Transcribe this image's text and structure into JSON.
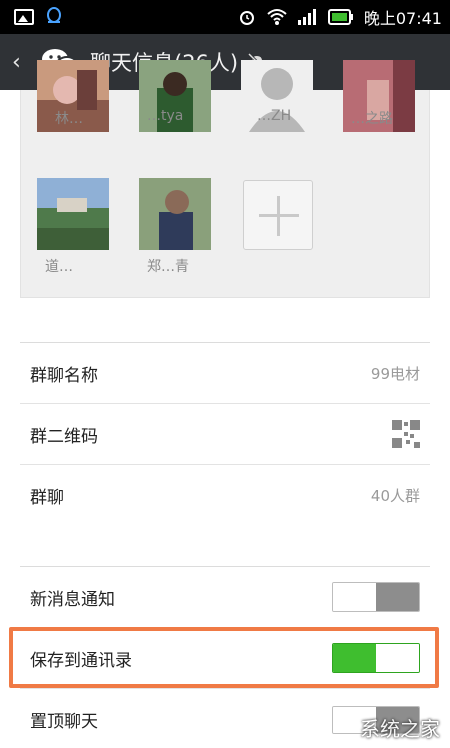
{
  "statusbar": {
    "time": "晚上07:41"
  },
  "header": {
    "title": "聊天信息(26人)",
    "back_icon": "chevron-left-icon",
    "logo_icon": "wechat-logo-icon",
    "mute_icon": "bell-muted-icon"
  },
  "members": [
    {
      "name": "林…"
    },
    {
      "name": "…tya"
    },
    {
      "name": "…ZH"
    },
    {
      "name": "…之路"
    },
    {
      "name": "道…"
    },
    {
      "name": "郑…青"
    }
  ],
  "settings": {
    "group_name": {
      "label": "群聊名称",
      "value": "99电材"
    },
    "qr_code": {
      "label": "群二维码"
    },
    "group": {
      "label": "群聊",
      "value": "40人群"
    },
    "notify": {
      "label": "新消息通知",
      "state": "off"
    },
    "save_contacts": {
      "label": "保存到通讯录",
      "state": "on"
    },
    "pin_chat": {
      "label": "置顶聊天"
    }
  },
  "watermark": "系统之家",
  "colors": {
    "header_bg": "#2f3236",
    "toggle_on": "#3fbe2f",
    "toggle_off": "#8d8d8d",
    "highlight": "#f07a45"
  }
}
